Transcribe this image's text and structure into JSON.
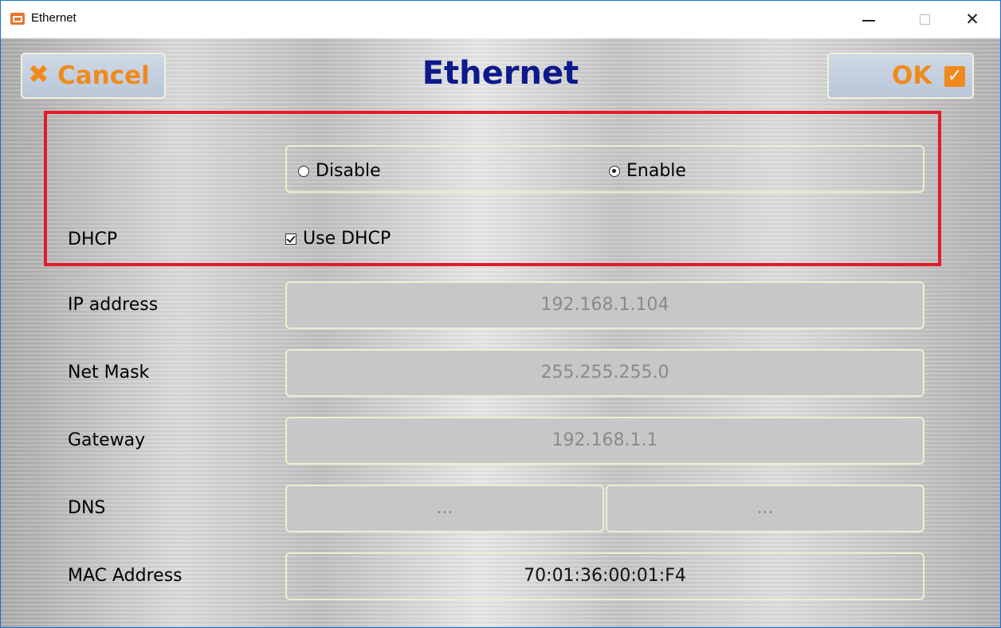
{
  "window": {
    "title": "Ethernet",
    "minimize": "—",
    "maximize": "☐",
    "close": "✕"
  },
  "header": {
    "cancel_label": "Cancel",
    "title": "Ethernet",
    "ok_label": "OK"
  },
  "ethernet": {
    "options": [
      "Disable",
      "Enable"
    ],
    "selected": "Enable"
  },
  "dhcp": {
    "label": "DHCP",
    "checkbox_label": "Use DHCP",
    "checked": true
  },
  "fields": {
    "ip": {
      "label": "IP address",
      "value": "192.168.1.104"
    },
    "mask": {
      "label": "Net Mask",
      "value": "255.255.255.0"
    },
    "gateway": {
      "label": "Gateway",
      "value": "192.168.1.1"
    },
    "dns": {
      "label": "DNS",
      "value1": "...",
      "value2": "..."
    },
    "mac": {
      "label": "MAC Address",
      "value": "70:01:36:00:01:F4"
    }
  },
  "colors": {
    "accent_orange": "#f08a1c",
    "title_blue": "#0d1a8c",
    "highlight_red": "#e11b2b"
  }
}
